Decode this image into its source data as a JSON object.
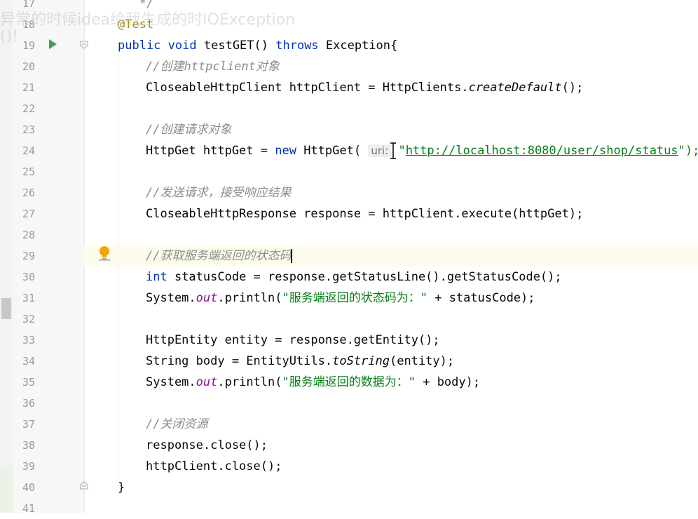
{
  "overlay": {
    "line1": "异常的时候idea给我生成的时IOException",
    "line2": "()!"
  },
  "editor": {
    "line_numbers": [
      "17",
      "18",
      "19",
      "20",
      "21",
      "22",
      "23",
      "24",
      "25",
      "26",
      "27",
      "28",
      "29",
      "30",
      "31",
      "32",
      "33",
      "34",
      "35",
      "36",
      "37",
      "38",
      "39",
      "40",
      "41"
    ],
    "annotation": "@Test",
    "method": {
      "public": "public",
      "void": "void",
      "name": "testGET() ",
      "throws": "throws",
      "rest": " Exception{"
    },
    "comment_create_client": "//创建httpclient对象",
    "client_line": {
      "pre": "CloseableHttpClient httpClient = HttpClients.",
      "call": "createDefault",
      "post": "();"
    },
    "comment_create_request": "//创建请求对象",
    "get_line": {
      "pre": "HttpGet httpGet = ",
      "new": "new",
      "mid": " HttpGet( ",
      "hint": "uri:",
      "q1": "\"",
      "url": "http://localhost:8080/user/shop/status",
      "post": "\");"
    },
    "comment_send": "//发送请求，接受响应结果",
    "execute_line": "CloseableHttpResponse response = httpClient.execute(httpGet);",
    "comment_status": "//获取服务端返回的状态码",
    "status_line": {
      "int": "int",
      "rest": " statusCode = response.getStatusLine().getStatusCode();"
    },
    "print_status": {
      "pre": "System.",
      "field": "out",
      "mid": ".println(",
      "str": "\"服务端返回的状态码为：\"",
      "post": " + statusCode);"
    },
    "entity_line": "HttpEntity entity = response.getEntity();",
    "body_line": {
      "pre": "String body = EntityUtils.",
      "call": "toString",
      "post": "(entity);"
    },
    "print_body": {
      "pre": "System.",
      "field": "out",
      "mid": ".println(",
      "str": "\"服务端返回的数据为：\"",
      "post": " + body);"
    },
    "comment_close": "//关闭资源",
    "close_response": "response.close();",
    "close_client": "httpClient.close();",
    "closing_brace": "}"
  },
  "icons": {
    "run": "run-icon",
    "bulb": "lightbulb-icon",
    "fold": "fold-icon"
  },
  "colors": {
    "keyword": "#0033b3",
    "annotation": "#9e880d",
    "comment": "#8c8c8c",
    "string": "#067d17",
    "current_line": "#fdfbec"
  }
}
